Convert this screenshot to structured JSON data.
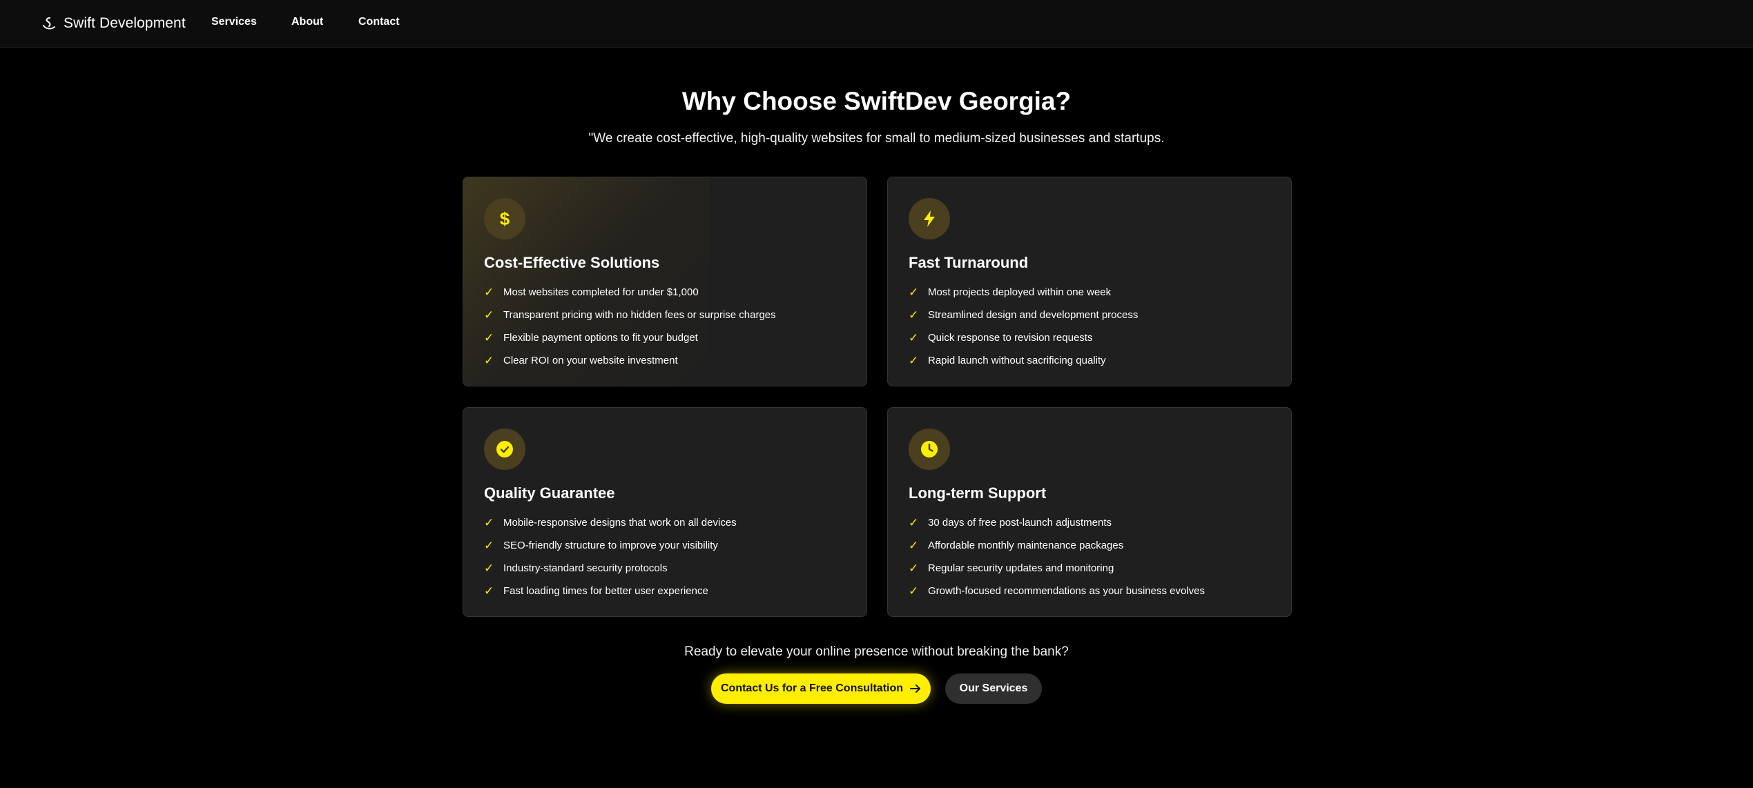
{
  "nav": {
    "brand": "Swift Development",
    "links": [
      "Services",
      "About",
      "Contact"
    ]
  },
  "hero": {
    "title": "Why Choose SwiftDev Georgia?",
    "subtitle": "\"We create cost-effective, high-quality websites for small to medium-sized businesses and startups."
  },
  "cards": [
    {
      "icon": "dollar-icon",
      "title": "Cost-Effective Solutions",
      "items": [
        "Most websites completed for under $1,000",
        "Transparent pricing with no hidden fees or surprise charges",
        "Flexible payment options to fit your budget",
        "Clear ROI on your website investment"
      ]
    },
    {
      "icon": "lightning-icon",
      "title": "Fast Turnaround",
      "items": [
        "Most projects deployed within one week",
        "Streamlined design and development process",
        "Quick response to revision requests",
        "Rapid launch without sacrificing quality"
      ]
    },
    {
      "icon": "check-circle-icon",
      "title": "Quality Guarantee",
      "items": [
        "Mobile-responsive designs that work on all devices",
        "SEO-friendly structure to improve your visibility",
        "Industry-standard security protocols",
        "Fast loading times for better user experience"
      ]
    },
    {
      "icon": "clock-icon",
      "title": "Long-term Support",
      "items": [
        "30 days of free post-launch adjustments",
        "Affordable monthly maintenance packages",
        "Regular security updates and monitoring",
        "Growth-focused recommendations as your business evolves"
      ]
    }
  ],
  "check_glyph": "✓",
  "cta": {
    "text": "Ready to elevate your online presence without breaking the bank?",
    "primary_label": "Contact Us for a Free Consultation",
    "secondary_label": "Our Services"
  },
  "colors": {
    "accent": "#ffee00",
    "background": "#000000",
    "card": "#1f1f1f",
    "icon_bg": "#4a3f1e"
  }
}
